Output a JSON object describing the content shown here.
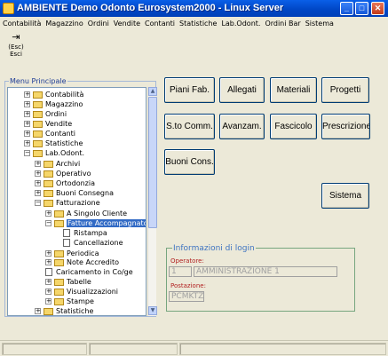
{
  "window": {
    "title": "AMBIENTE Demo Odonto Eurosystem2000  - Linux Server"
  },
  "titlebar_buttons": {
    "minimize": "_",
    "maximize": "□",
    "close": "✕"
  },
  "menubar": [
    "Contabilità",
    "Magazzino",
    "Ordini",
    "Vendite",
    "Contanti",
    "Statistiche",
    "Lab.Odont.",
    "Ordini Bar",
    "Sistema"
  ],
  "toolbar": {
    "exit_label_1": "(Esc)",
    "exit_label_2": "Esci",
    "exit_icon": "door-exit-icon"
  },
  "menu_principale": {
    "legend": "Menu Principale",
    "tree": [
      {
        "label": "Contabilità",
        "expander": "+",
        "icon": "folder"
      },
      {
        "label": "Magazzino",
        "expander": "+",
        "icon": "folder"
      },
      {
        "label": "Ordini",
        "expander": "+",
        "icon": "folder"
      },
      {
        "label": "Vendite",
        "expander": "+",
        "icon": "folder"
      },
      {
        "label": "Contanti",
        "expander": "+",
        "icon": "folder"
      },
      {
        "label": "Statistiche",
        "expander": "+",
        "icon": "folder"
      },
      {
        "label": "Lab.Odont.",
        "expander": "−",
        "icon": "folder"
      },
      {
        "label": "Archivi",
        "expander": "+",
        "icon": "folder"
      },
      {
        "label": "Operativo",
        "expander": "+",
        "icon": "folder"
      },
      {
        "label": "Ortodonzia",
        "expander": "+",
        "icon": "folder"
      },
      {
        "label": "Buoni Consegna",
        "expander": "+",
        "icon": "folder"
      },
      {
        "label": "Fatturazione",
        "expander": "−",
        "icon": "folder"
      },
      {
        "label": "A Singolo Cliente",
        "expander": "+",
        "icon": "folder"
      },
      {
        "label": "Fatture Accompagnatorie",
        "expander": "−",
        "icon": "folder"
      },
      {
        "label": "Ristampa",
        "expander": "",
        "icon": "doc"
      },
      {
        "label": "Cancellazione",
        "expander": "",
        "icon": "doc"
      },
      {
        "label": "Periodica",
        "expander": "+",
        "icon": "folder"
      },
      {
        "label": "Note Accredito",
        "expander": "+",
        "icon": "folder"
      },
      {
        "label": "Caricamento in Co/ge",
        "expander": "",
        "icon": "doc"
      },
      {
        "label": "Tabelle",
        "expander": "+",
        "icon": "folder"
      },
      {
        "label": "Visualizzazioni",
        "expander": "+",
        "icon": "folder"
      },
      {
        "label": "Stampe",
        "expander": "+",
        "icon": "folder"
      },
      {
        "label": "Statistiche",
        "expander": "+",
        "icon": "folder"
      }
    ],
    "selected_item": "Fatture Accompagnatorie"
  },
  "buttons": {
    "piani_fab": "Piani Fab.",
    "allegati": "Allegati",
    "materiali": "Materiali",
    "progetti": "Progetti",
    "sto_comm": "S.to Comm.",
    "avanzam": "Avanzam.",
    "fascicolo": "Fascicolo",
    "prescrizione": "Prescrizione",
    "buoni_cons": "Buoni Cons.",
    "sistema": "Sistema"
  },
  "login_info": {
    "legend": "Informazioni di login",
    "operatore_label": "Operatore:",
    "operatore_code": "1",
    "operatore_name": "AMMINISTRAZIONE 1",
    "postazione_label": "Postazione:",
    "postazione_value": "PCMKTZ"
  }
}
